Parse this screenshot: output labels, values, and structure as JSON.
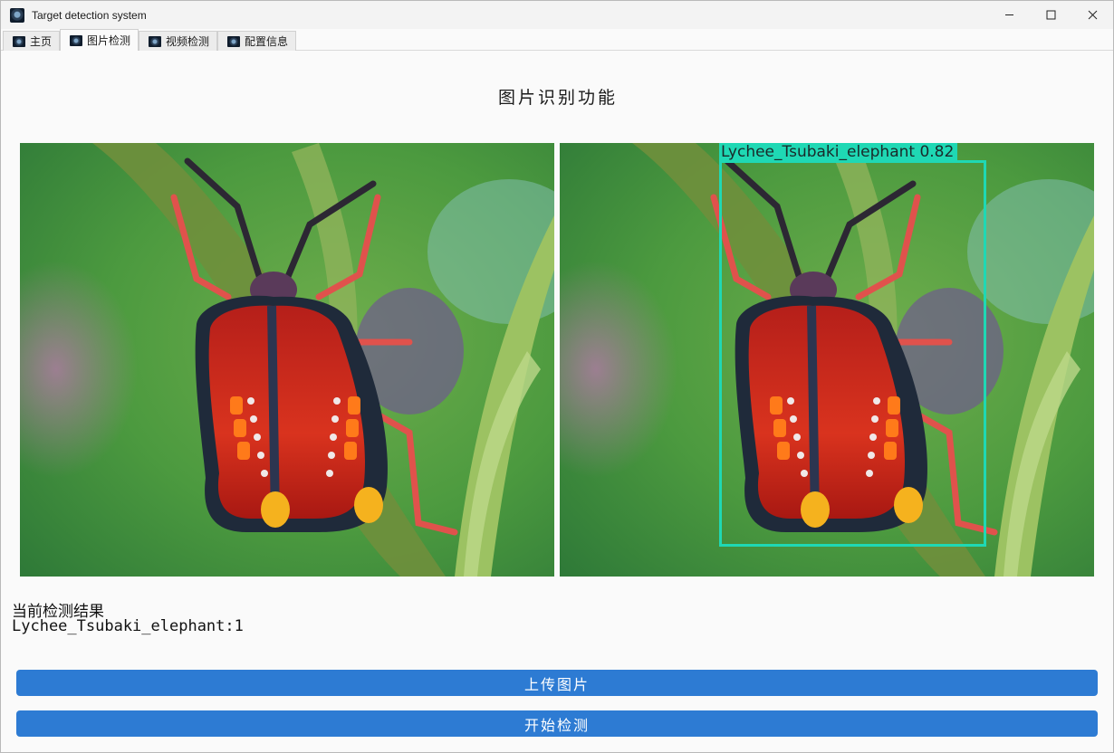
{
  "window": {
    "title": "Target detection system",
    "icon": "app-icon"
  },
  "tabs": [
    {
      "label": "主页",
      "icon": "tab-icon",
      "active": false
    },
    {
      "label": "图片检测",
      "icon": "tab-icon",
      "active": true
    },
    {
      "label": "视频检测",
      "icon": "tab-icon",
      "active": false
    },
    {
      "label": "配置信息",
      "icon": "tab-icon",
      "active": false
    }
  ],
  "main": {
    "title": "图片识别功能",
    "detection": {
      "class_name": "Lychee_Tsubaki_elephant",
      "score": "0.82",
      "label": "Lychee_Tsubaki_elephant 0.82"
    },
    "result": {
      "heading": "当前检测结果",
      "line": "Lychee_Tsubaki_elephant:1"
    },
    "buttons": {
      "upload": "上传图片",
      "start": "开始检测"
    }
  },
  "colors": {
    "accent": "#2d7bd3",
    "detection_box": "#1fd8b4"
  }
}
